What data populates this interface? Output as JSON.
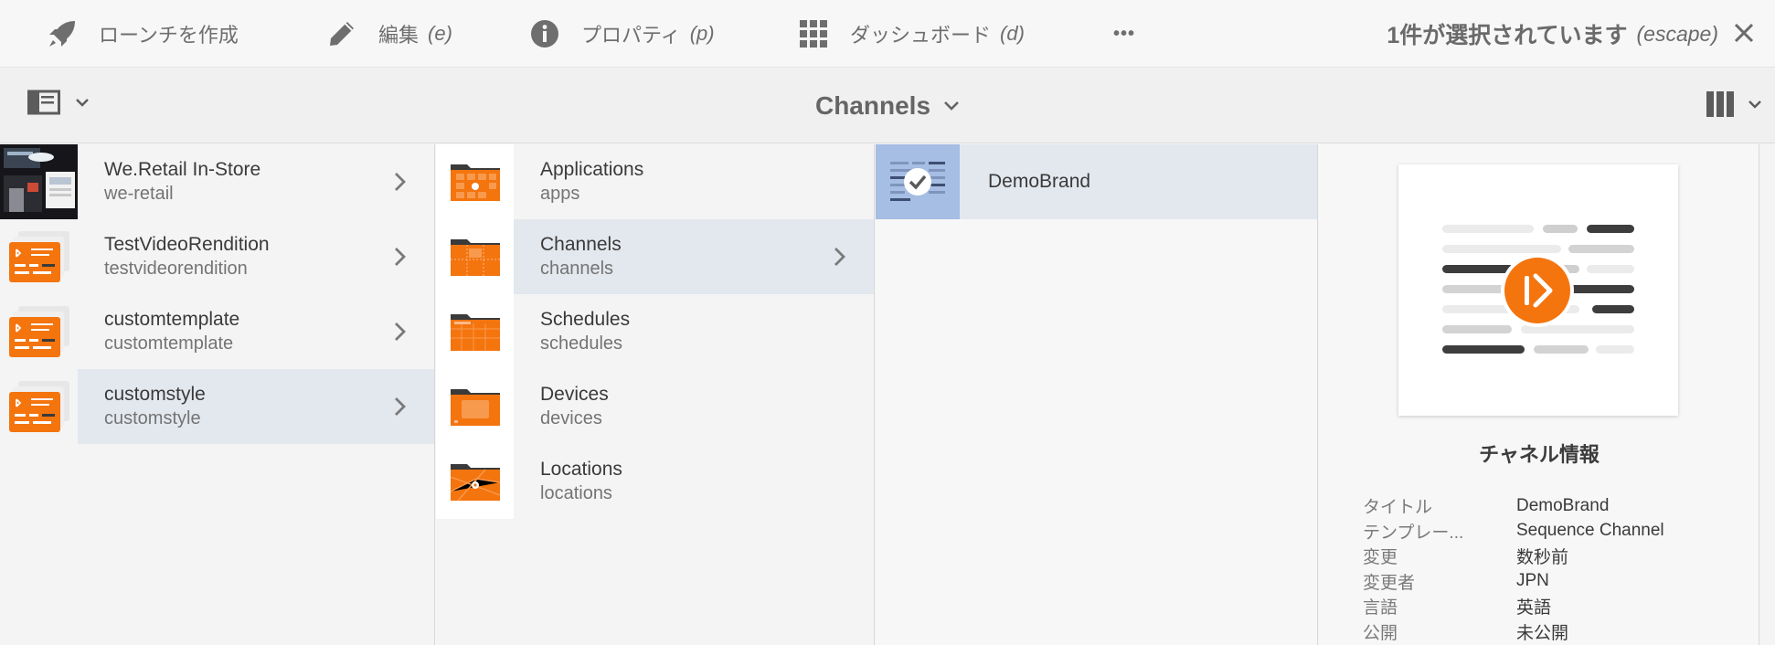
{
  "actionbar": {
    "launch": {
      "label": "ローンチを作成",
      "icon": "rocket-icon"
    },
    "edit": {
      "label": "編集",
      "key": "(e)",
      "icon": "pencil-icon"
    },
    "properties": {
      "label": "プロパティ",
      "key": "(p)",
      "icon": "info-icon"
    },
    "dashboard": {
      "label": "ダッシュボード",
      "key": "(d)",
      "icon": "grid-icon"
    },
    "more": {
      "label": "•••",
      "icon": "more-icon"
    },
    "selection": {
      "label": "1件が選択されています",
      "key": "(escape)"
    },
    "close": {
      "icon": "close-icon"
    }
  },
  "titlebar": {
    "title": "Channels",
    "rail_icon": "rail-toggle-icon",
    "view_icon": "column-view-icon"
  },
  "column1": [
    {
      "title": "We.Retail In-Store",
      "sub": "we-retail",
      "selected": false
    },
    {
      "title": "TestVideoRendition",
      "sub": "testvideorendition",
      "selected": false
    },
    {
      "title": "customtemplate",
      "sub": "customtemplate",
      "selected": false
    },
    {
      "title": "customstyle",
      "sub": "customstyle",
      "selected": true
    }
  ],
  "column2": [
    {
      "title": "Applications",
      "sub": "apps",
      "selected": false
    },
    {
      "title": "Channels",
      "sub": "channels",
      "selected": true
    },
    {
      "title": "Schedules",
      "sub": "schedules",
      "selected": false
    },
    {
      "title": "Devices",
      "sub": "devices",
      "selected": false
    },
    {
      "title": "Locations",
      "sub": "locations",
      "selected": false
    }
  ],
  "column3": [
    {
      "title": "DemoBrand",
      "selected": true
    }
  ],
  "details": {
    "heading": "チャネル情報",
    "rows": [
      {
        "key": "タイトル",
        "value": "DemoBrand"
      },
      {
        "key": "テンプレー...",
        "value": "Sequence Channel"
      },
      {
        "key": "変更",
        "value": "数秒前"
      },
      {
        "key": "変更者",
        "value": "JPN"
      },
      {
        "key": "言語",
        "value": "英語"
      },
      {
        "key": "公開",
        "value": "未公開"
      }
    ]
  },
  "colors": {
    "accent_orange": "#f4740e",
    "selection_bg": "#e3e8ef",
    "selected_thumb": "#a6bde4"
  }
}
